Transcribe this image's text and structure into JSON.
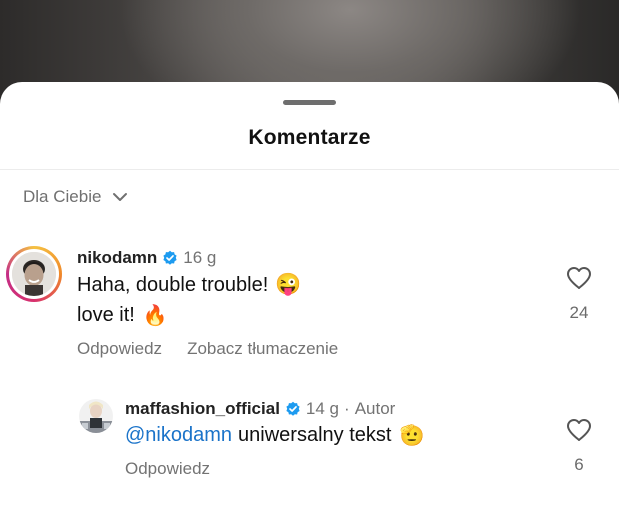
{
  "sheet": {
    "title": "Komentarze"
  },
  "sort": {
    "label": "Dla Ciebie"
  },
  "comments": [
    {
      "username": "nikodamn",
      "time": "16 g",
      "lines": [
        "Haha, double trouble!",
        "love it!"
      ],
      "emoji": [
        "😜",
        "🔥"
      ],
      "likes": "24",
      "actions": [
        "Odpowiedz",
        "Zobacz tłumaczenie"
      ]
    }
  ],
  "reply": {
    "username": "maffashion_official",
    "time": "14 g",
    "separator": "·",
    "badge": "Autor",
    "mention": "@nikodamn",
    "text": "uniwersalny tekst",
    "emoji": "🫡",
    "likes": "6",
    "action": "Odpowiedz"
  },
  "icons": {
    "verified": "verified-badge-icon",
    "like": "heart-outline-icon",
    "sort": "chevron-down-icon"
  },
  "colors": {
    "verified": "#1d9bf0",
    "mention": "#1a73c9",
    "muted": "#737373"
  }
}
